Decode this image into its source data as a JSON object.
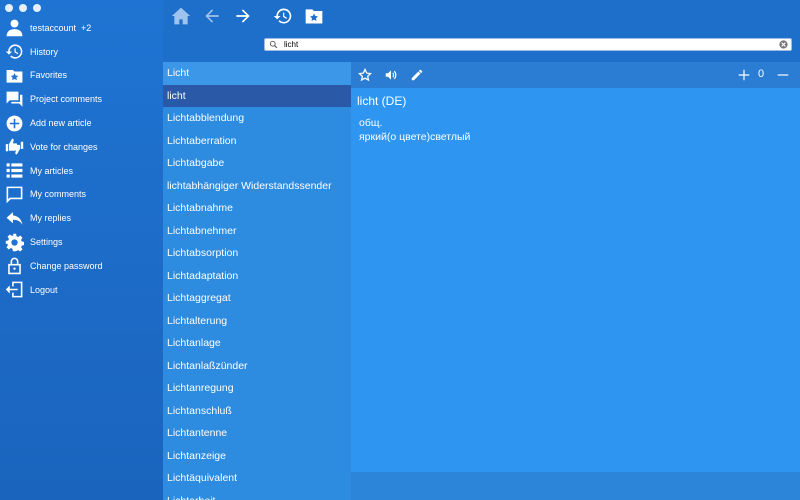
{
  "sidebar": {
    "items": [
      {
        "label": "testaccount",
        "extra": "+2",
        "icon": "user-icon"
      },
      {
        "label": "History",
        "icon": "history-icon"
      },
      {
        "label": "Favorites",
        "icon": "favorites-icon"
      },
      {
        "label": "Project comments",
        "icon": "comments-icon"
      },
      {
        "label": "Add new article",
        "icon": "add-circle-icon"
      },
      {
        "label": "Vote for changes",
        "icon": "thumbs-icon"
      },
      {
        "label": "My articles",
        "icon": "list-icon"
      },
      {
        "label": "My comments",
        "icon": "comment-icon"
      },
      {
        "label": "My replies",
        "icon": "reply-icon"
      },
      {
        "label": "Settings",
        "icon": "gear-icon"
      },
      {
        "label": "Change password",
        "icon": "lock-icon"
      },
      {
        "label": "Logout",
        "icon": "logout-icon"
      }
    ]
  },
  "search": {
    "value": "licht"
  },
  "words": [
    "Licht",
    "licht",
    "Lichtabblendung",
    "Lichtaberration",
    "Lichtabgabe",
    "lichtabhängiger Widerstandssender",
    "Lichtabnahme",
    "Lichtabnehmer",
    "Lichtabsorption",
    "Lichtadaptation",
    "Lichtaggregat",
    "Lichtalterung",
    "Lichtanlage",
    "Lichtanlaßzünder",
    "Lichtanregung",
    "Lichtanschluß",
    "Lichtantenne",
    "Lichtanzeige",
    "Lichtäquivalent",
    "Lichtarbeit"
  ],
  "article": {
    "title": "licht (DE)",
    "lines": [
      "общ.",
      "яркий(о цвете)светлый"
    ],
    "counter": "0"
  },
  "colors": {
    "sidebar": "#1f74d3",
    "list": "#2d8be0",
    "selected": "#2a5aa7",
    "article": "#2e95f0"
  }
}
